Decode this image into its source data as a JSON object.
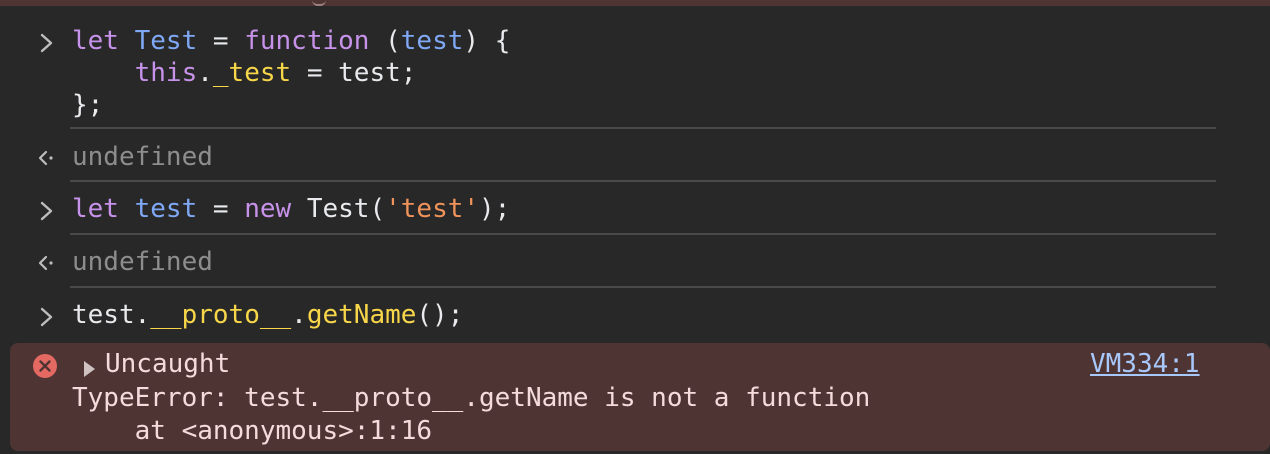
{
  "entries": [
    {
      "kind": "input",
      "lines": [
        [
          {
            "t": "let",
            "c": "kw"
          },
          {
            "t": " ",
            "c": "plain"
          },
          {
            "t": "Test",
            "c": "kw-blue"
          },
          {
            "t": " = ",
            "c": "plain"
          },
          {
            "t": "function",
            "c": "kw"
          },
          {
            "t": " (",
            "c": "plain"
          },
          {
            "t": "test",
            "c": "kw-blue"
          },
          {
            "t": ") {",
            "c": "plain"
          }
        ],
        [
          {
            "t": "    ",
            "c": "plain"
          },
          {
            "t": "this",
            "c": "kw"
          },
          {
            "t": ".",
            "c": "plain"
          },
          {
            "t": "_test",
            "c": "prop"
          },
          {
            "t": " = test;",
            "c": "plain"
          }
        ],
        [
          {
            "t": "};",
            "c": "plain"
          }
        ]
      ]
    },
    {
      "kind": "output",
      "text": "undefined"
    },
    {
      "kind": "input",
      "lines": [
        [
          {
            "t": "let",
            "c": "kw"
          },
          {
            "t": " ",
            "c": "plain"
          },
          {
            "t": "test",
            "c": "kw-blue"
          },
          {
            "t": " = ",
            "c": "plain"
          },
          {
            "t": "new",
            "c": "kw"
          },
          {
            "t": " Test(",
            "c": "plain"
          },
          {
            "t": "'test'",
            "c": "str"
          },
          {
            "t": ");",
            "c": "plain"
          }
        ]
      ]
    },
    {
      "kind": "output",
      "text": "undefined"
    },
    {
      "kind": "input",
      "lines": [
        [
          {
            "t": "test.",
            "c": "plain"
          },
          {
            "t": "__proto__",
            "c": "prop"
          },
          {
            "t": ".",
            "c": "plain"
          },
          {
            "t": "getName",
            "c": "prop"
          },
          {
            "t": "();",
            "c": "plain"
          }
        ]
      ]
    }
  ],
  "error": {
    "header": "Uncaught",
    "source_link": "VM334:1",
    "message": "TypeError: test.__proto__.getName is not a function",
    "stack": "    at <anonymous>:1:16"
  },
  "icons": {
    "input_prompt": "chevron-right-icon",
    "output_prompt": "return-arrow-icon",
    "error": "error-circle-icon",
    "expand": "triangle-right-icon"
  },
  "colors": {
    "background": "#282828",
    "error_background": "#4e3534",
    "keyword": "#c792ea",
    "identifier": "#7fa8f5",
    "property": "#f7d64a",
    "string": "#f0935b",
    "muted": "#8d8d8d",
    "link": "#a8c7fa",
    "error_icon": "#e46962"
  }
}
